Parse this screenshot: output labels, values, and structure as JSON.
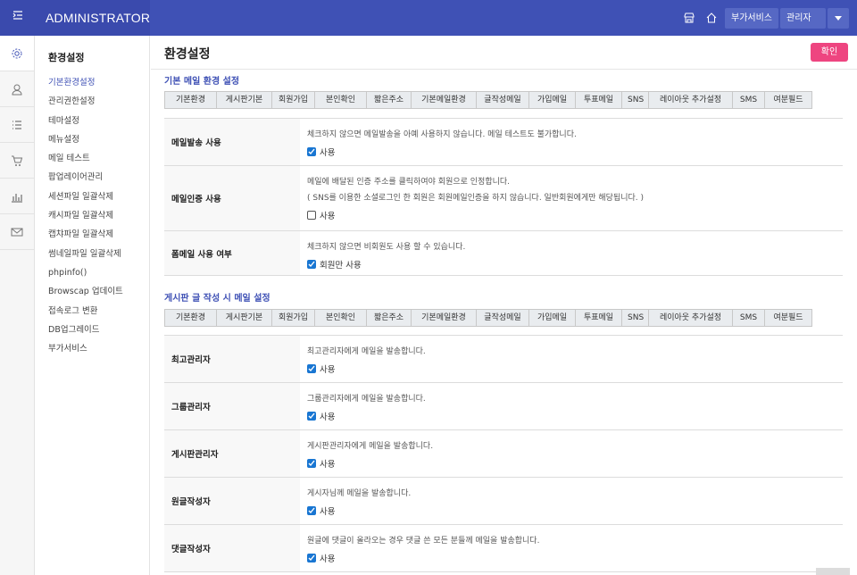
{
  "topbar": {
    "brand": "ADMINISTRATOR",
    "addon_label": "부가서비스",
    "admin_label": "관리자"
  },
  "rail": [
    "gear-icon",
    "user-icon",
    "list-icon",
    "cart-icon",
    "chart-icon",
    "mail-icon"
  ],
  "submenu": {
    "heading": "환경설정",
    "items": [
      "기본환경설정",
      "관리권한설정",
      "테마설정",
      "메뉴설정",
      "메일 테스트",
      "팝업레이어관리",
      "세션파일 일괄삭제",
      "캐시파일 일괄삭제",
      "캡챠파일 일괄삭제",
      "썸네일파일 일괄삭제",
      "phpinfo()",
      "Browscap 업데이트",
      "접속로그 변환",
      "DB업그레이드",
      "부가서비스"
    ]
  },
  "page": {
    "title": "환경설정",
    "confirm": "확인"
  },
  "tabs": [
    "기본환경",
    "게시판기본",
    "회원가입",
    "본인확인",
    "짧은주소",
    "기본메일환경",
    "글작성메일",
    "가입메일",
    "투표메일",
    "SNS",
    "레이아웃 추가설정",
    "SMS",
    "여분필드"
  ],
  "section1": {
    "title": "기본 메일 환경 설정",
    "rows": [
      {
        "label": "메일발송 사용",
        "lines": [
          "체크하지 않으면 메일발송을 아예 사용하지 않습니다. 메일 테스트도 불가합니다."
        ],
        "check": "사용",
        "checked": true
      },
      {
        "label": "메일인증 사용",
        "lines": [
          "메일에 배달된 인증 주소를 클릭하여야 회원으로 인정합니다.",
          "( SNS를 이용한 소셜로그인 한 회원은 회원메일인증을 하지 않습니다. 일반회원에게만 해당됩니다. )"
        ],
        "check": "사용",
        "checked": false
      },
      {
        "label": "폼메일 사용 여부",
        "lines": [
          "체크하지 않으면 비회원도 사용 할 수 있습니다."
        ],
        "check": "회원만 사용",
        "checked": true
      }
    ]
  },
  "section2": {
    "title": "게시판 글 작성 시 메일 설정",
    "rows": [
      {
        "label": "최고관리자",
        "lines": [
          "최고관리자에게 메일을 발송합니다."
        ],
        "check": "사용",
        "checked": true
      },
      {
        "label": "그룹관리자",
        "lines": [
          "그룹관리자에게 메일을 발송합니다."
        ],
        "check": "사용",
        "checked": true
      },
      {
        "label": "게시판관리자",
        "lines": [
          "게시판관리자에게 메일을 발송합니다."
        ],
        "check": "사용",
        "checked": true
      },
      {
        "label": "원글작성자",
        "lines": [
          "게시자님께 메일을 발송합니다."
        ],
        "check": "사용",
        "checked": true
      },
      {
        "label": "댓글작성자",
        "lines": [
          "원글에 댓글이 올라오는 경우 댓글 쓴 모든 분들께 메일을 발송합니다."
        ],
        "check": "사용",
        "checked": true
      }
    ]
  }
}
